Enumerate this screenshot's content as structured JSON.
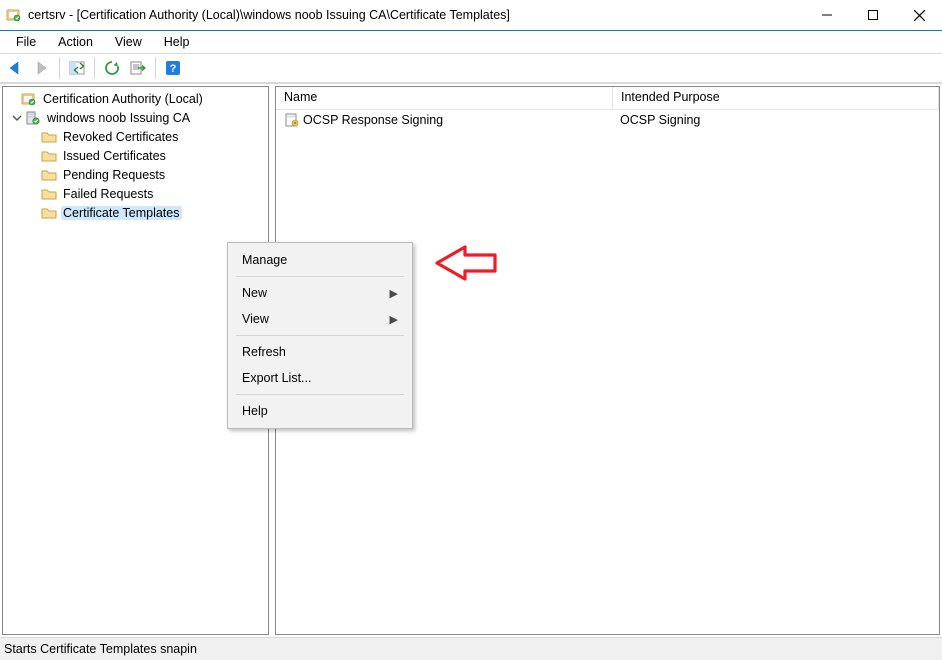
{
  "window": {
    "title": "certsrv - [Certification Authority (Local)\\windows noob Issuing CA\\Certificate Templates]"
  },
  "menu": {
    "file": "File",
    "action": "Action",
    "view": "View",
    "help": "Help"
  },
  "tree": {
    "root": "Certification Authority (Local)",
    "ca": "windows noob Issuing CA",
    "children": {
      "revoked": "Revoked Certificates",
      "issued": "Issued Certificates",
      "pending": "Pending Requests",
      "failed": "Failed Requests",
      "templates": "Certificate Templates"
    }
  },
  "list": {
    "columns": {
      "name": "Name",
      "purpose": "Intended Purpose"
    },
    "rows": [
      {
        "name": "OCSP Response Signing",
        "purpose": "OCSP Signing"
      }
    ]
  },
  "context_menu": {
    "manage": "Manage",
    "new": "New",
    "view": "View",
    "refresh": "Refresh",
    "export": "Export List...",
    "help": "Help"
  },
  "status": "Starts Certificate Templates snapin"
}
